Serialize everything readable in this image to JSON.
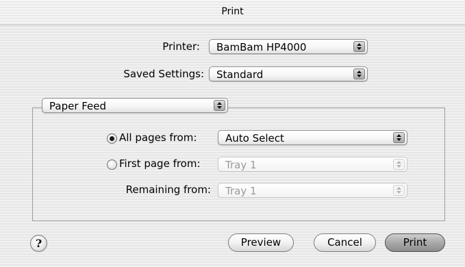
{
  "window": {
    "title": "Print"
  },
  "printer": {
    "label": "Printer:",
    "value": "BamBam HP4000"
  },
  "saved_settings": {
    "label": "Saved Settings:",
    "value": "Standard"
  },
  "panel": {
    "value": "Paper Feed"
  },
  "paper_feed": {
    "all_pages": {
      "label": "All pages from:",
      "selected": true,
      "value": "Auto Select",
      "enabled": true
    },
    "first_page": {
      "label": "First page from:",
      "selected": false,
      "value": "Tray 1",
      "enabled": false
    },
    "remaining": {
      "label": "Remaining from:",
      "value": "Tray 1",
      "enabled": false
    }
  },
  "buttons": {
    "help": "?",
    "preview": "Preview",
    "cancel": "Cancel",
    "print": "Print"
  },
  "icons": {
    "popup_arrows": "up-down-arrows-icon",
    "help": "question-mark-icon"
  }
}
